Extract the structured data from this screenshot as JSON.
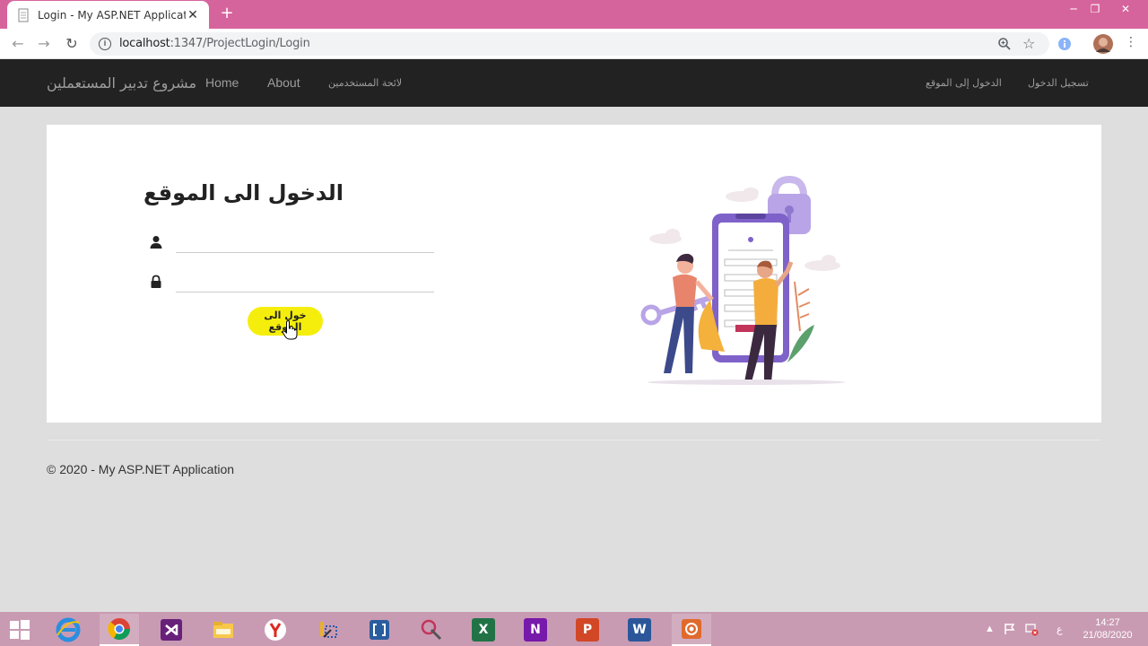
{
  "browser": {
    "tab_title": "Login - My ASP.NET Application",
    "tab_close": "✕",
    "new_tab": "+",
    "url_host": "localhost",
    "url_path": ":1347/ProjectLogin/Login",
    "window_controls": [
      "─",
      "❐",
      "✕"
    ]
  },
  "navbar": {
    "brand": "مشروع تدبير المستعملين",
    "links": [
      {
        "label": "Home"
      },
      {
        "label": "About"
      },
      {
        "label": "لائحة المستخدمين"
      }
    ],
    "right_links": [
      {
        "label": "الدخول إلى الموقع"
      },
      {
        "label": "تسجيل الدخول"
      }
    ]
  },
  "login": {
    "title": "الدخول الى الموقع",
    "username_value": "",
    "password_value": "",
    "button_label": "خول الى الموقع"
  },
  "footer": {
    "text": "© 2020 - My ASP.NET Application"
  },
  "taskbar": {
    "apps": [
      {
        "icon": "windows-start-icon"
      },
      {
        "icon": "internet-explorer-icon"
      },
      {
        "icon": "chrome-icon"
      },
      {
        "icon": "visual-studio-icon"
      },
      {
        "icon": "file-explorer-icon"
      },
      {
        "icon": "yandex-icon"
      },
      {
        "icon": "tools-icon"
      },
      {
        "icon": "brackets-icon"
      },
      {
        "icon": "snipping-icon"
      },
      {
        "icon": "excel-icon",
        "glyph": "X"
      },
      {
        "icon": "onenote-icon",
        "glyph": "N"
      },
      {
        "icon": "powerpoint-icon",
        "glyph": "P"
      },
      {
        "icon": "word-icon",
        "glyph": "W"
      },
      {
        "icon": "recorder-icon"
      }
    ],
    "language": "ع",
    "time": "14:27",
    "date": "21/08/2020"
  },
  "colors": {
    "tabstrip": "#d6649c",
    "navbar": "#222222",
    "button": "#f5ee0c",
    "taskbar": "#c99bb3"
  }
}
